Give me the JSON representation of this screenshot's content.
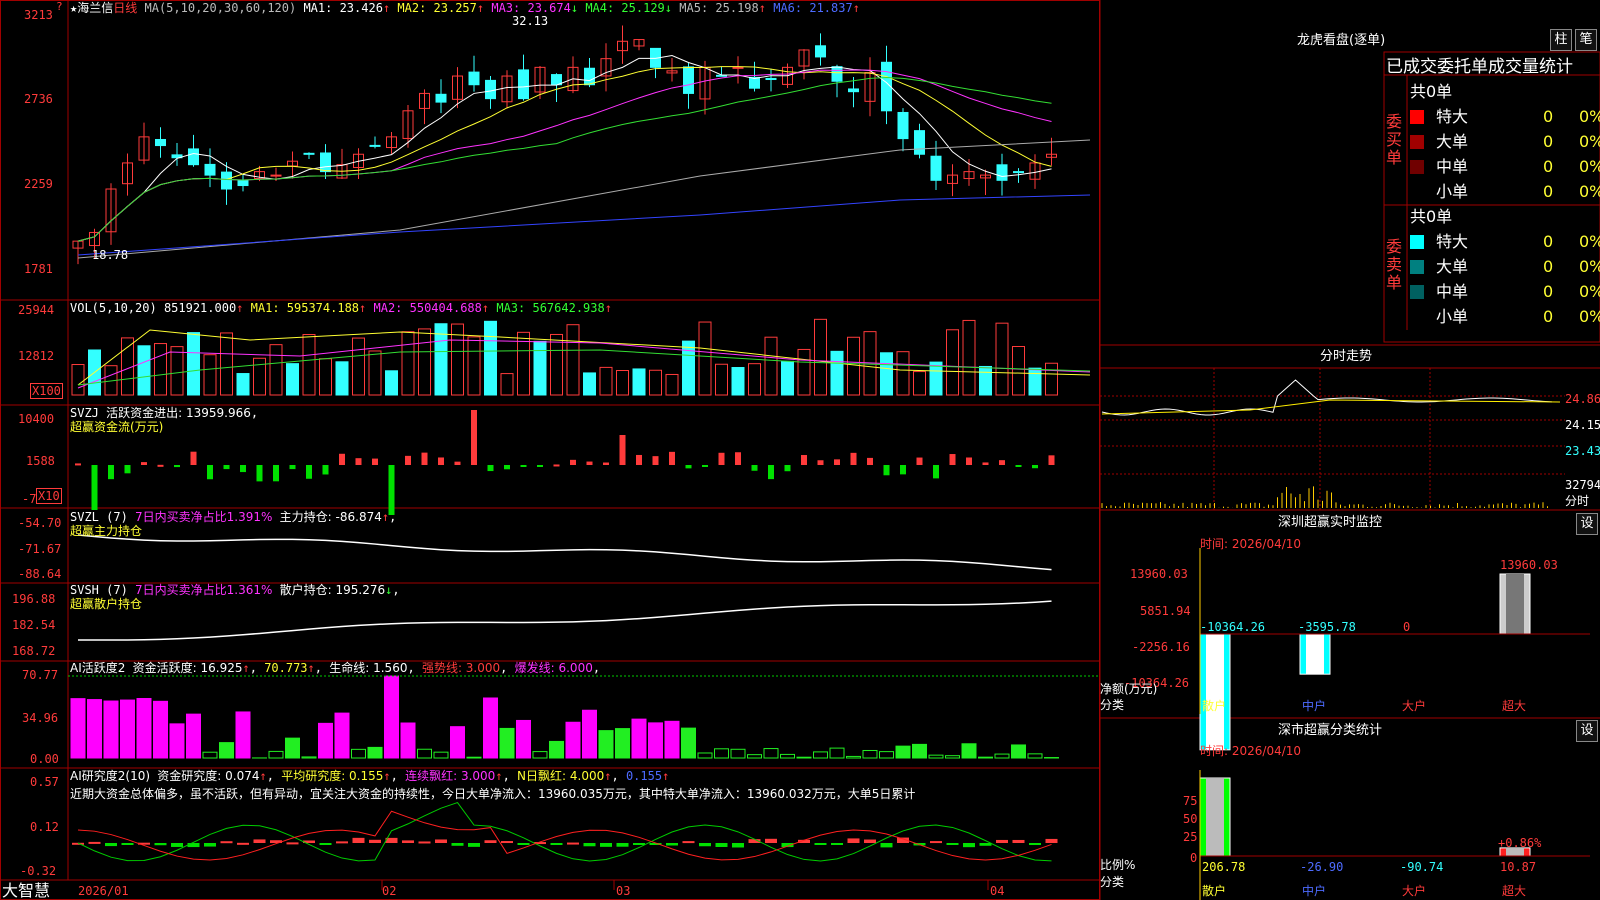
{
  "colors": {
    "up": "#ff3b3b",
    "down": "#33ffff",
    "ma1": "#ffffff",
    "ma2": "#ffff33",
    "ma3": "#ff33ff",
    "ma4": "#33dd33",
    "ma5": "#aaaaaa",
    "ma6": "#3344ff",
    "grid": "#aa0000"
  },
  "main": {
    "star": "★",
    "stock_name": "海兰信",
    "period": "日线",
    "ma_label": "MA(5,10,20,30,60,120)",
    "ma1": "MA1: 23.426",
    "ma2": "MA2: 23.257",
    "ma3": "MA3: 23.674",
    "ma4": "MA4: 25.129",
    "ma5": "MA5: 25.198",
    "ma6": "MA6: 21.837",
    "up_arrow": "↑",
    "down_arrow": "↓",
    "ticks": [
      "3213",
      "2736",
      "2259",
      "1781"
    ],
    "high_label": "32.13",
    "low_label": "18.78",
    "q_mark": "?"
  },
  "vol": {
    "label": "VOL(5,10,20)",
    "val": "851921.000",
    "ma1": "MA1: 595374.188",
    "ma2": "MA2: 550404.688",
    "ma3": "MA3: 567642.938",
    "ticks": [
      "25944",
      "12812"
    ],
    "unit": "X100"
  },
  "svzj": {
    "label": "SVZJ",
    "desc": "活跃资金进出: 13959.966",
    "sub": "超赢资金流(万元)",
    "ticks": [
      "10400",
      "1588",
      "-7"
    ],
    "unit": "X10"
  },
  "svzl": {
    "label": "SVZL (7)",
    "net": "7日内买卖净占比1.391%",
    "pos": "主力持仓: -86.874",
    "sub": "超赢主力持仓",
    "ticks": [
      "-54.70",
      "-71.67",
      "-88.64"
    ]
  },
  "svsh": {
    "label": "SVSH (7)",
    "net": "7日内买卖净占比1.361%",
    "pos": "散户持仓: 195.276",
    "sub": "超赢散户持仓",
    "ticks": [
      "196.88",
      "182.54",
      "168.72"
    ]
  },
  "ai1": {
    "label": "AI活跃度2",
    "act": "资金活跃度: 16.925",
    "avg": "70.773",
    "life": "生命线: 1.560",
    "strong": "强势线: 3.000",
    "burst": "爆发线: 6.000",
    "ticks": [
      "70.77",
      "34.96",
      "0.00"
    ]
  },
  "ai2": {
    "label": "AI研究度2(10)",
    "res": "资金研究度: 0.074",
    "avg": "平均研究度: 0.155",
    "red": "连续飘红: 3.000",
    "nred": "N日飘红: 4.000",
    "last": "0.155",
    "comment": "近期大资金总体偏多，虽不活跃，但有异动，宜关注大资金的持续性，今日大单净流入：13960.035万元，其中特大单净流入：13960.032万元，大单5日累计",
    "ticks": [
      "0.57",
      "0.12",
      "-0.32"
    ]
  },
  "xaxis": {
    "labels": [
      "2026/01",
      "02",
      "03",
      "04"
    ]
  },
  "brand": "大智慧",
  "dragon": {
    "title": "龙虎看盘(逐单)",
    "btn1": "柱",
    "btn2": "笔",
    "header": "已成交委托单成交量统计",
    "buy_total": "共0单",
    "buy_side": "委买单",
    "sell_total": "共0单",
    "sell_side": "委卖单",
    "rows": [
      {
        "name": "特大",
        "qty": "0",
        "pct": "0%"
      },
      {
        "name": "大单",
        "qty": "0",
        "pct": "0%"
      },
      {
        "name": "中单",
        "qty": "0",
        "pct": "0%"
      },
      {
        "name": "小单",
        "qty": "0",
        "pct": "0%"
      }
    ],
    "buy_colors": [
      "#ff0000",
      "#a00000",
      "#700000",
      ""
    ],
    "sell_colors": [
      "#00ffff",
      "#008080",
      "#006060",
      ""
    ]
  },
  "intraday": {
    "title": "分时走势",
    "ticks": [
      "24.86",
      "24.15",
      "23.43"
    ],
    "vol_tick": "32794",
    "vol_label": "分时"
  },
  "sz_monitor": {
    "title": "深圳超赢实时监控",
    "btn": "设",
    "time": "时间: 2026/04/10",
    "ticks": [
      "13960.03",
      "5851.94",
      "-2256.16",
      "-10364.26"
    ],
    "axis_label1": "净额(万元)",
    "axis_label2": "分类",
    "cats": [
      "散户",
      "中户",
      "大户",
      "超大"
    ],
    "values": [
      -10364.26,
      -3595.78,
      0,
      13960.03
    ],
    "labels": [
      "-10364.26",
      "-3595.78",
      "0",
      "13960.03"
    ]
  },
  "sz_class": {
    "title": "深市超赢分类统计",
    "btn": "设",
    "time": "时间: 2026/04/10",
    "ticks": [
      "75",
      "50",
      "25",
      "0"
    ],
    "axis_label1": "比例%",
    "axis_label2": "分类",
    "cats": [
      "散户",
      "中户",
      "大户",
      "超大"
    ],
    "values": [
      206.78,
      -26.9,
      -90.74,
      10.87
    ],
    "labels": [
      "206.78",
      "-26.90",
      "-90.74",
      "10.87"
    ],
    "extra": "+0.86%"
  }
}
